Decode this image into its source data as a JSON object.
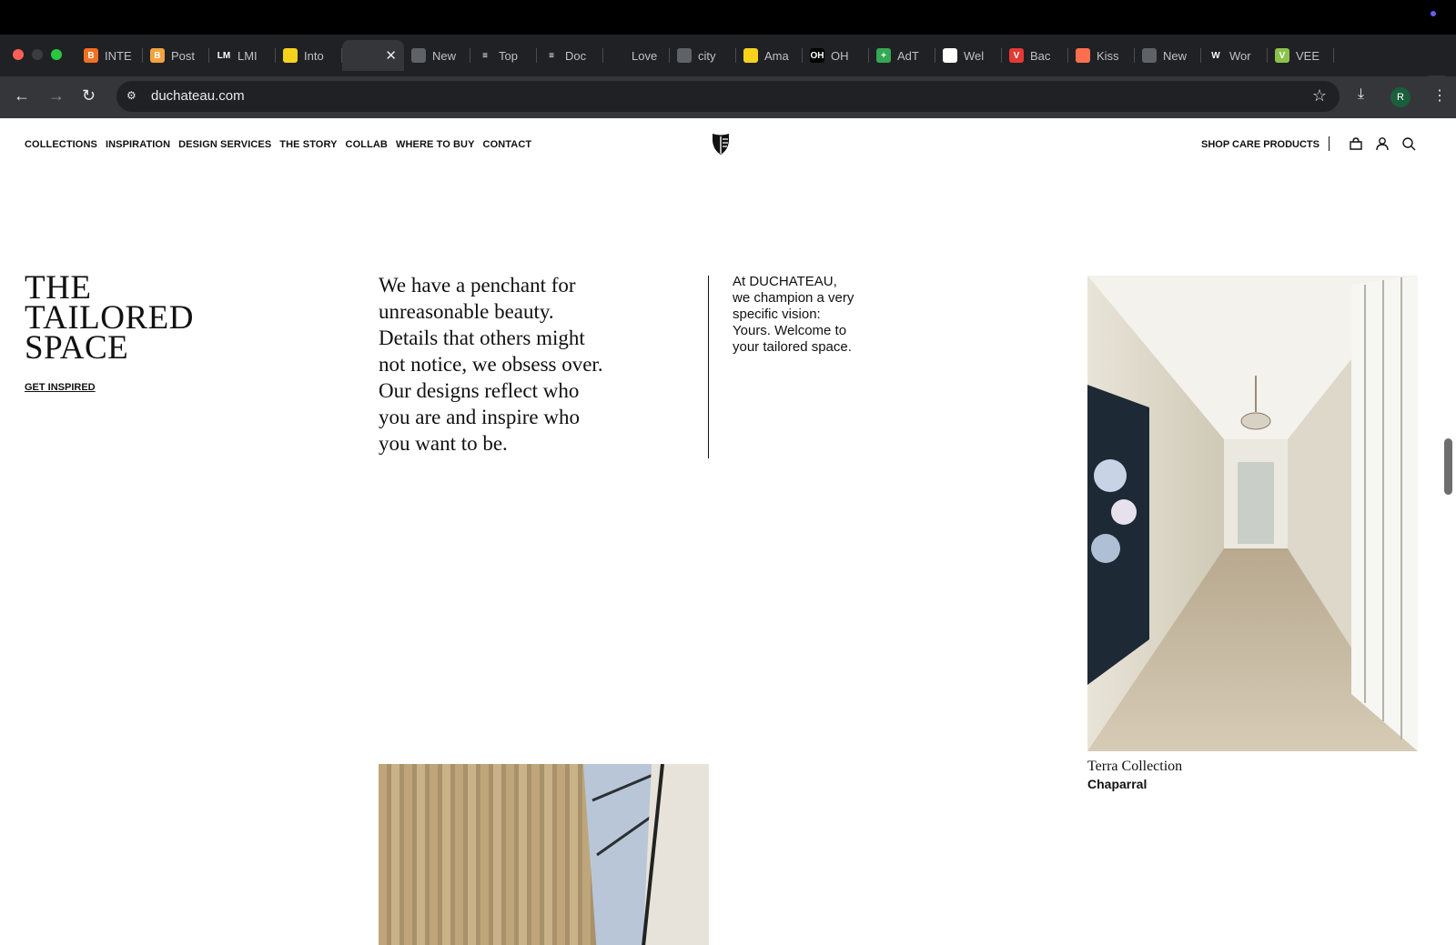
{
  "browser": {
    "tabs": [
      {
        "label": "INTE",
        "fav_color": "#f36f21",
        "fav_glyph": "B"
      },
      {
        "label": "Post",
        "fav_color": "#f4a340",
        "fav_glyph": "B"
      },
      {
        "label": "LMI",
        "fav_color": "#202124",
        "fav_glyph": "LM"
      },
      {
        "label": "Into",
        "fav_color": "#f7d21c",
        "fav_glyph": ""
      },
      {
        "label": "",
        "fav_color": "#35363a",
        "fav_glyph": "",
        "active": true
      },
      {
        "label": "New",
        "fav_color": "#5f6368",
        "fav_glyph": ""
      },
      {
        "label": "Top",
        "fav_color": "#202124",
        "fav_glyph": "≡"
      },
      {
        "label": "Doc",
        "fav_color": "#202124",
        "fav_glyph": "≡"
      },
      {
        "label": "Love",
        "fav_color": "#202124",
        "fav_glyph": ""
      },
      {
        "label": "city",
        "fav_color": "#5f6368",
        "fav_glyph": ""
      },
      {
        "label": "Ama",
        "fav_color": "#f7d21c",
        "fav_glyph": ""
      },
      {
        "label": "OH",
        "fav_color": "#000000",
        "fav_glyph": "OH"
      },
      {
        "label": "AdT",
        "fav_color": "#34a853",
        "fav_glyph": "+"
      },
      {
        "label": "Wel",
        "fav_color": "#ffffff",
        "fav_glyph": ""
      },
      {
        "label": "Bac",
        "fav_color": "#e53935",
        "fav_glyph": "V"
      },
      {
        "label": "Kiss",
        "fav_color": "#ff6f4e",
        "fav_glyph": ""
      },
      {
        "label": "New",
        "fav_color": "#5f6368",
        "fav_glyph": ""
      },
      {
        "label": "Wor",
        "fav_color": "#202124",
        "fav_glyph": "W"
      },
      {
        "label": "VEE",
        "fav_color": "#8bc34a",
        "fav_glyph": "V"
      }
    ],
    "url": "duchateau.com"
  },
  "site": {
    "nav": [
      "COLLECTIONS",
      "INSPIRATION",
      "DESIGN SERVICES",
      "THE STORY",
      "COLLAB",
      "WHERE TO BUY",
      "CONTACT"
    ],
    "shop_care": "SHOP CARE PRODUCTS"
  },
  "hero": {
    "title_lines": [
      "THE",
      "TAILORED",
      "SPACE"
    ],
    "cta": "GET INSPIRED",
    "quote": "We have a penchant for unreasonable beauty. Details that others might not notice, we obsess over. Our designs reflect who you are and inspire who you want to be.",
    "side_text": "At DUCHATEAU, we champion a very specific vision: Yours. Welcome to your tailored space."
  },
  "feature": {
    "collection": "Terra Collection",
    "name": "Chaparral"
  }
}
